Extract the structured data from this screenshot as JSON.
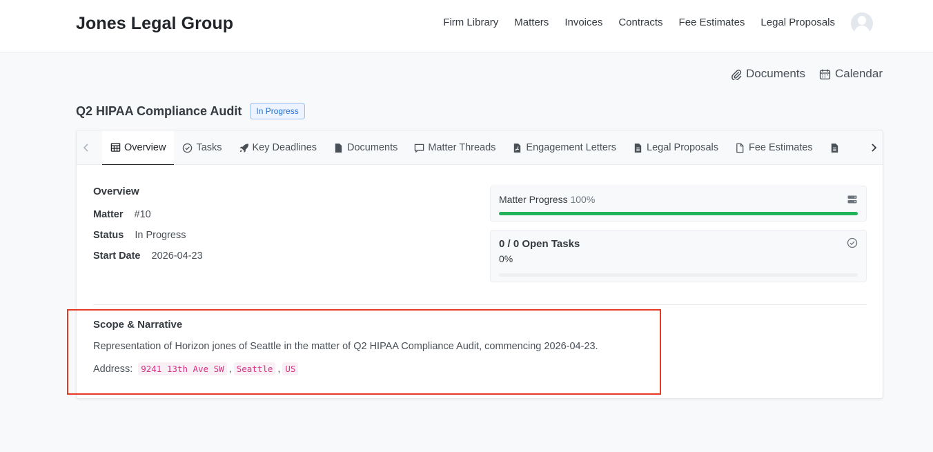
{
  "brand": "Jones Legal Group",
  "nav": [
    "Firm Library",
    "Matters",
    "Invoices",
    "Contracts",
    "Fee Estimates",
    "Legal Proposals"
  ],
  "actions": {
    "documents": "Documents",
    "calendar": "Calendar"
  },
  "matter": {
    "title": "Q2 HIPAA Compliance Audit",
    "status_badge": "In Progress"
  },
  "tabs": [
    {
      "label": "Overview",
      "icon": "table-icon"
    },
    {
      "label": "Tasks",
      "icon": "check-circle-icon"
    },
    {
      "label": "Key Deadlines",
      "icon": "rocket-icon"
    },
    {
      "label": "Documents",
      "icon": "file-icon"
    },
    {
      "label": "Matter Threads",
      "icon": "chat-icon"
    },
    {
      "label": "Engagement Letters",
      "icon": "file-pdf-icon"
    },
    {
      "label": "Legal Proposals",
      "icon": "file-text-icon"
    },
    {
      "label": "Fee Estimates",
      "icon": "file-outline-icon"
    },
    {
      "label": "",
      "icon": "file-text-icon"
    }
  ],
  "overview": {
    "heading": "Overview",
    "fields": [
      {
        "key": "Matter",
        "value": "#10"
      },
      {
        "key": "Status",
        "value": "In Progress"
      },
      {
        "key": "Start Date",
        "value": "2026-04-23"
      }
    ]
  },
  "progress": {
    "label": "Matter Progress",
    "percent_text": "100%",
    "fraction": 1.0
  },
  "tasks": {
    "title": "0 / 0 Open Tasks",
    "percent_text": "0%",
    "fraction": 0
  },
  "scope": {
    "heading": "Scope & Narrative",
    "text": "Representation of Horizon jones of Seattle in the matter of Q2 HIPAA Compliance Audit, commencing 2026-04-23.",
    "address_label": "Address:",
    "address_parts": [
      "9241 13th Ave SW",
      "Seattle",
      "US"
    ]
  },
  "colors": {
    "accent": "#1f6fd1",
    "progress": "#21b35a",
    "code": "#d63384",
    "highlight": "#e53923"
  }
}
